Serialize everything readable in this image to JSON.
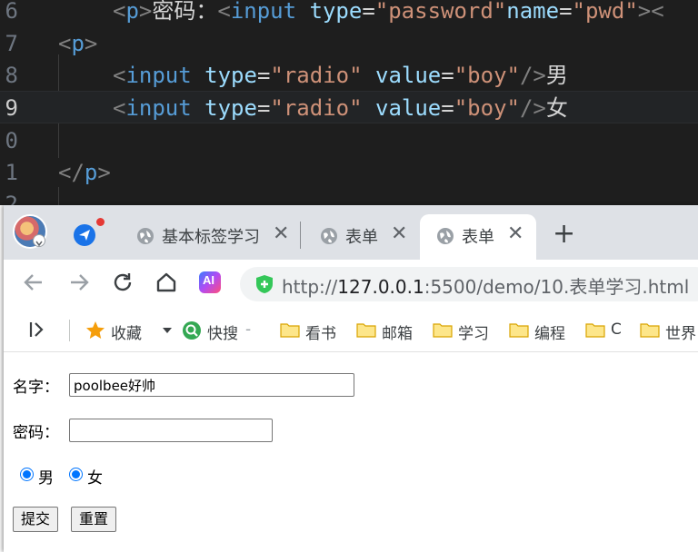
{
  "editor": {
    "lines": [
      {
        "num": "6",
        "tokens": [
          {
            "t": "<",
            "c": "t-bracket"
          },
          {
            "t": "p",
            "c": "t-tag"
          },
          {
            "t": ">",
            "c": "t-bracket"
          },
          {
            "t": "密码：",
            "c": "t-text"
          },
          {
            "t": "<",
            "c": "t-bracket"
          },
          {
            "t": "input",
            "c": "t-tag"
          },
          {
            "t": " type",
            "c": "t-attr"
          },
          {
            "t": "=",
            "c": "t-text"
          },
          {
            "t": "\"password\"",
            "c": "t-str"
          },
          {
            "t": "name",
            "c": "t-attr"
          },
          {
            "t": "=",
            "c": "t-text"
          },
          {
            "t": "\"pwd\"",
            "c": "t-str"
          },
          {
            "t": "><",
            "c": "t-bracket"
          }
        ]
      },
      {
        "num": "7",
        "tokens": [
          {
            "t": "<",
            "c": "t-bracket"
          },
          {
            "t": "p",
            "c": "t-tag"
          },
          {
            "t": ">",
            "c": "t-bracket"
          }
        ]
      },
      {
        "num": "8",
        "tokens": [
          {
            "t": "<",
            "c": "t-bracket"
          },
          {
            "t": "input",
            "c": "t-tag"
          },
          {
            "t": " type",
            "c": "t-attr"
          },
          {
            "t": "=",
            "c": "t-text"
          },
          {
            "t": "\"radio\"",
            "c": "t-str"
          },
          {
            "t": " value",
            "c": "t-attr"
          },
          {
            "t": "=",
            "c": "t-text"
          },
          {
            "t": "\"boy\"",
            "c": "t-str"
          },
          {
            "t": "/>",
            "c": "t-bracket"
          },
          {
            "t": "男",
            "c": "t-text"
          }
        ]
      },
      {
        "num": "9",
        "tokens": [
          {
            "t": "<",
            "c": "t-bracket"
          },
          {
            "t": "input",
            "c": "t-tag"
          },
          {
            "t": " type",
            "c": "t-attr"
          },
          {
            "t": "=",
            "c": "t-text"
          },
          {
            "t": "\"radio\"",
            "c": "t-str"
          },
          {
            "t": " value",
            "c": "t-attr"
          },
          {
            "t": "=",
            "c": "t-text"
          },
          {
            "t": "\"boy\"",
            "c": "t-str"
          },
          {
            "t": "/>",
            "c": "t-bracket"
          },
          {
            "t": "女",
            "c": "t-text"
          }
        ]
      },
      {
        "num": "0",
        "tokens": []
      },
      {
        "num": "1",
        "tokens": [
          {
            "t": "</",
            "c": "t-bracket"
          },
          {
            "t": "p",
            "c": "t-tag"
          },
          {
            "t": ">",
            "c": "t-bracket"
          }
        ]
      },
      {
        "num": "2",
        "tokens": []
      }
    ]
  },
  "browser": {
    "tabs": [
      {
        "title": "基本标签学习",
        "close": "✕"
      },
      {
        "title": "表单",
        "close": "✕"
      },
      {
        "title": "表单",
        "close": "✕"
      }
    ],
    "new_tab": "+",
    "ai_label": "AI",
    "address": {
      "scheme": "http://",
      "host": "127.0.0.1",
      "rest": ":5500/demo/10.表单学习.html"
    },
    "bookmarks": {
      "favorites": "收藏",
      "quick_search": "快搜",
      "quick_search_suffix": "-",
      "folders": [
        "看书",
        "邮箱",
        "学习",
        "编程",
        "C",
        "世界"
      ]
    }
  },
  "form": {
    "name_label": "名字：",
    "name_value": "poolbee好帅",
    "password_label": "密码：",
    "password_value": "",
    "radio_male_label": "男",
    "radio_female_label": "女",
    "submit_label": "提交",
    "reset_label": "重置"
  },
  "colors": {
    "editor_bg": "#1e1e1e",
    "tag": "#569cd6",
    "attr": "#9cdcfe",
    "string": "#ce9178",
    "radio_accent": "#0075ff"
  }
}
